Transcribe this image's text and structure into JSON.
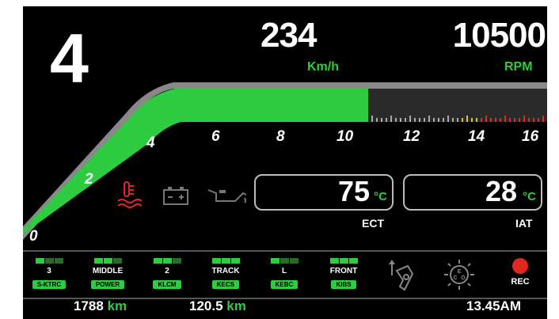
{
  "gear": "4",
  "speed": {
    "value": "234",
    "unit": "Km/h"
  },
  "rpm": {
    "value": "10500",
    "unit": "RPM",
    "level": 10.5,
    "max": 16
  },
  "tacho_labels": [
    "0",
    "2",
    "4",
    "6",
    "8",
    "10",
    "12",
    "14",
    "16"
  ],
  "warning_icons": [
    "coolant-temp-icon",
    "battery-icon",
    "oil-pressure-icon"
  ],
  "colors": {
    "accent": "#2ecc40",
    "warning": "#e0281e",
    "redline": "#e0281e",
    "yellow": "#e0c020"
  },
  "ect": {
    "value": "75",
    "unit": "°C",
    "label": "ECT"
  },
  "iat": {
    "value": "28",
    "unit": "°C",
    "label": "IAT"
  },
  "modes": [
    {
      "value": "3",
      "name": "S-KTRC",
      "bars": 3,
      "on": 1
    },
    {
      "value": "MIDDLE",
      "name": "POWER",
      "bars": 3,
      "on": 2
    },
    {
      "value": "2",
      "name": "KLCM",
      "bars": 3,
      "on": 2
    },
    {
      "value": "TRACK",
      "name": "KECS",
      "bars": 3,
      "on": 3
    },
    {
      "value": "L",
      "name": "KEBC",
      "bars": 3,
      "on": 1
    },
    {
      "value": "FRONT",
      "name": "KIBS",
      "bars": 3,
      "on": 3
    }
  ],
  "rec_label": "REC",
  "odometer": {
    "value": "1788",
    "unit": "km"
  },
  "trip": {
    "value": "120.5",
    "unit": "km"
  },
  "clock": "13.45AM"
}
